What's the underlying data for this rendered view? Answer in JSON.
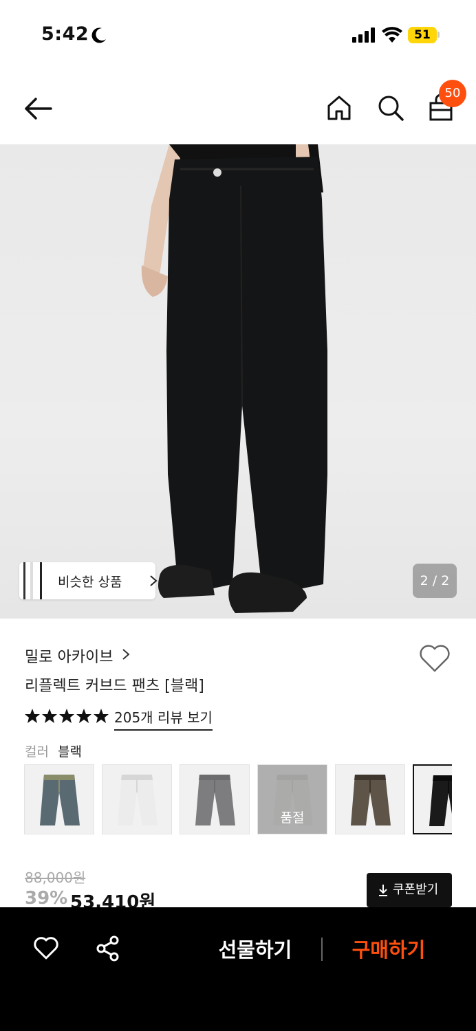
{
  "status_bar": {
    "time": "5:42",
    "battery": "51"
  },
  "nav": {
    "cart_count": "50",
    "icons": [
      "back-arrow-icon",
      "home-icon",
      "search-icon",
      "shopping-bag-icon"
    ]
  },
  "gallery": {
    "similar_label": "비슷한 상품",
    "page_indicator": "2 / 2"
  },
  "product": {
    "brand": "밀로 아카이브",
    "title": "리플렉트 커브드 팬츠 [블랙]",
    "rating_stars": 5,
    "reviews_label": "205개 리뷰 보기",
    "color_label": "컬러",
    "color_value": "블랙",
    "swatches": [
      {
        "color": "#5a6a72",
        "shade": "#8a8d6a",
        "soldout": ""
      },
      {
        "color": "#ececec",
        "shade": "#d6d6d6",
        "soldout": ""
      },
      {
        "color": "#7d7d7f",
        "shade": "#6c6c6e",
        "soldout": ""
      },
      {
        "color": "#e9e9e7",
        "shade": "#d8d8d6",
        "soldout": "품절"
      },
      {
        "color": "#5e5448",
        "shade": "#3f362d",
        "soldout": ""
      },
      {
        "color": "#1a1a1a",
        "shade": "#0c0c0c",
        "soldout": ""
      }
    ],
    "original_price": "88,000원",
    "discount": "39%",
    "sale_price": "53,410원",
    "coupon_label": "쿠폰받기"
  },
  "bottom_bar": {
    "gift_label": "선물하기",
    "buy_label": "구매하기"
  },
  "colors": {
    "accent": "#ff4f0f",
    "battery": "#ffd60a"
  }
}
